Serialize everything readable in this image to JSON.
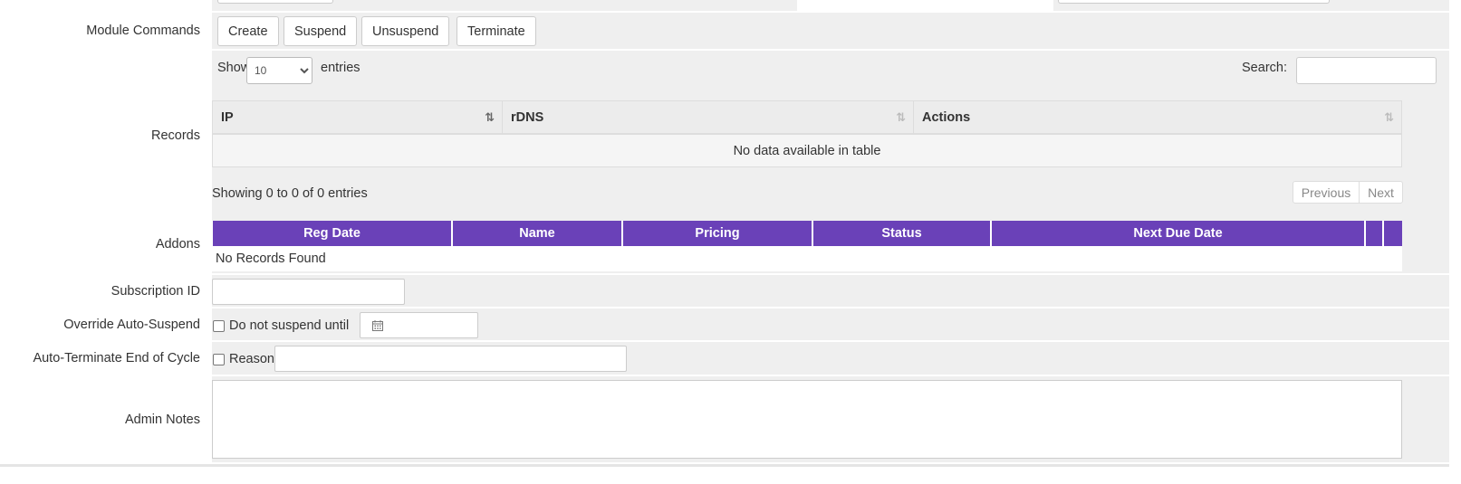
{
  "module_commands": {
    "label": "Module Commands",
    "buttons": [
      "Create",
      "Suspend",
      "Unsuspend",
      "Terminate"
    ]
  },
  "records": {
    "label": "Records",
    "show_label": "Show",
    "entries_value": "10",
    "entries_label": "entries",
    "search_label": "Search:",
    "search_value": "",
    "columns": [
      "IP",
      "rDNS",
      "Actions"
    ],
    "empty_message": "No data available in table",
    "info": "Showing 0 to 0 of 0 entries",
    "previous_label": "Previous",
    "next_label": "Next"
  },
  "addons": {
    "label": "Addons",
    "columns": [
      "Reg Date",
      "Name",
      "Pricing",
      "Status",
      "Next Due Date"
    ],
    "empty_message": "No Records Found",
    "header_color": "#6a41b8"
  },
  "subscription": {
    "label": "Subscription ID",
    "value": ""
  },
  "override_suspend": {
    "label": "Override Auto-Suspend",
    "checkbox_label": "Do not suspend until",
    "checked": false,
    "date_value": "",
    "icon": "calendar-icon"
  },
  "auto_terminate": {
    "label": "Auto-Terminate End of Cycle",
    "checkbox_label": "Reason",
    "checked": false,
    "reason_value": ""
  },
  "admin_notes": {
    "label": "Admin Notes",
    "value": ""
  }
}
